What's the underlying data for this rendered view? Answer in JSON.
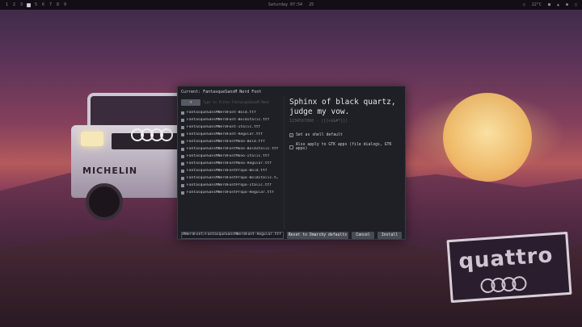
{
  "topbar": {
    "workspaces": [
      "1",
      "2",
      "3",
      "",
      "5",
      "6",
      "7",
      "8",
      "9"
    ],
    "clock_day": "Saturday 07:54",
    "clock_extra": "25",
    "tray": [
      "○",
      "22°C",
      "■",
      "▲",
      "●",
      "□"
    ]
  },
  "dialog": {
    "title": "Current: FantasqueSansM Nerd Font",
    "filter_label": "↑",
    "search_placeholder": "Type to filter FantasqueSansM Mono",
    "files": [
      "FantasqueSansMNerdFont-Bold.ttf",
      "FantasqueSansMNerdFont-BoldItalic.ttf",
      "FantasqueSansMNerdFont-Italic.ttf",
      "FantasqueSansMNerdFont-Regular.ttf",
      "FantasqueSansMNerdFontMono-Bold.ttf",
      "FantasqueSansMNerdFontMono-BoldItalic.ttf",
      "FantasqueSansMNerdFontMono-Italic.ttf",
      "FantasqueSansMNerdFontMono-Regular.ttf",
      "FantasqueSansMNerdFontPropo-Bold.ttf",
      "FantasqueSansMNerdFontPropo-BoldItalic.t…",
      "FantasqueSansMNerdFontPropo-Italic.ttf",
      "FantasqueSansMNerdFontPropo-Regular.ttf"
    ],
    "preview_text": "Sphinx of black quartz, judge my vow.",
    "preview_digits": "1234567890 - ([{+$&#*}])",
    "opt_shell": {
      "label": "Set as shell default",
      "checked": true
    },
    "opt_gtk": {
      "label": "Also apply to GTK apps (file dialogs, GTK apps)",
      "checked": false
    },
    "path_value": "nsMNerdFont/FantasqueSansMNerdFont-Regular.ttf",
    "reset_label": "Reset to Omarchy defaults",
    "cancel_label": "Cancel",
    "install_label": "Install"
  },
  "wallpaper": {
    "car_text": "MICHELIN",
    "sign_text": "quattro"
  }
}
